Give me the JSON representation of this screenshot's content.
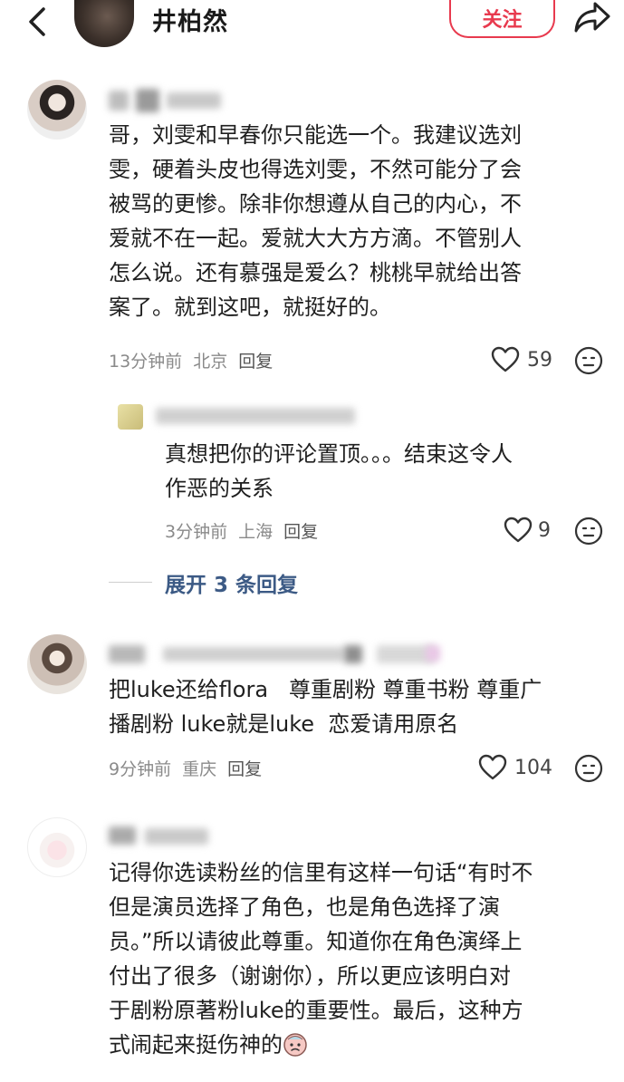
{
  "header": {
    "name": "井柏然",
    "follow_label": "关注"
  },
  "comments": [
    {
      "text_lines": [
        "哥，刘雯和早春你只能选一个。我建议选刘",
        "雯，硬着头皮也得选刘雯，不然可能分了会",
        "被骂的更惨。除非你想遵从自己的内心，不",
        "爱就不在一起。爱就大大方方滴。不管别人",
        "怎么说。还有慕强是爱么？桃桃早就给出答",
        "案了。就到这吧，就挺好的。"
      ],
      "time": "13分钟前",
      "location": "北京",
      "reply_label": "回复",
      "likes": "59",
      "reply": {
        "text_lines": [
          "真想把你的评论置顶。。。结束这令人",
          "作恶的关系"
        ],
        "time": "3分钟前",
        "location": "上海",
        "reply_label": "回复",
        "likes": "9"
      },
      "expand_label": "展开 3 条回复"
    },
    {
      "text_lines": [
        "把luke还给flora   尊重剧粉 尊重书粉 尊重广",
        "播剧粉 luke就是luke  恋爱请用原名"
      ],
      "time": "9分钟前",
      "location": "重庆",
      "reply_label": "回复",
      "likes": "104"
    },
    {
      "text_lines": [
        "记得你选读粉丝的信里有这样一句话“有时不",
        "但是演员选择了角色，也是角色选择了演",
        "员。”所以请彼此尊重。知道你在角色演绎上",
        "付出了很多（谢谢你），所以更应该明白对",
        "于剧粉原著粉luke的重要性。最后，这种方",
        "式闹起来挺伤神的"
      ]
    }
  ],
  "colors": {
    "accent": "#e83a4e",
    "link": "#3c5a85",
    "meta": "#8a8a8a"
  },
  "icons": [
    "back-icon",
    "share-icon",
    "heart-icon",
    "emoji-face-icon",
    "sad-face-emoji-icon"
  ]
}
